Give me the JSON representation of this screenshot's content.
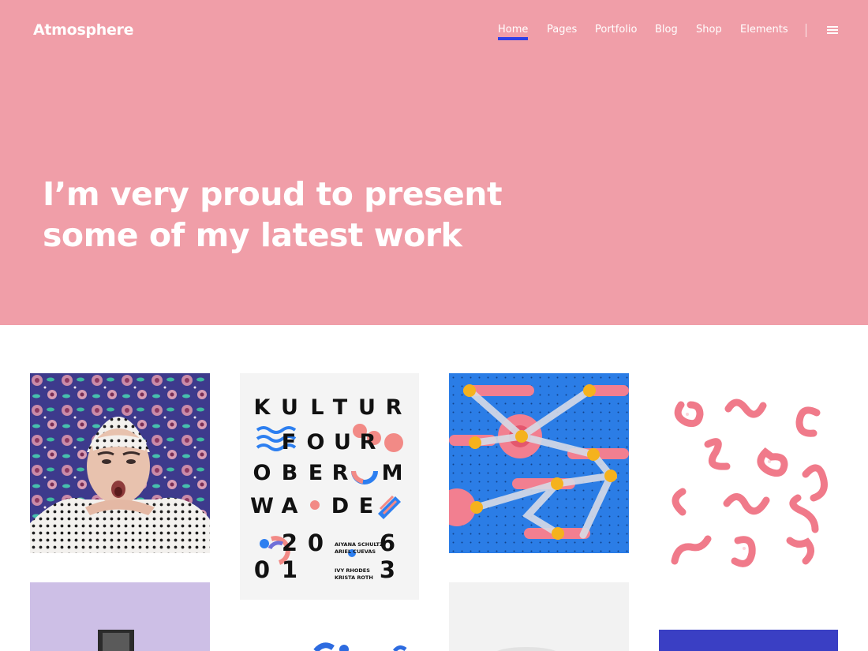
{
  "brand": {
    "name": "Atmosphere"
  },
  "nav": {
    "items": [
      {
        "label": "Home",
        "active": true
      },
      {
        "label": "Pages"
      },
      {
        "label": "Portfolio"
      },
      {
        "label": "Blog"
      },
      {
        "label": "Shop"
      },
      {
        "label": "Elements"
      }
    ],
    "menu_icon": "hamburger-icon"
  },
  "hero": {
    "title_line1": "I’m very proud to present",
    "title_line2": "some of my latest work",
    "background": "#f09ea8"
  },
  "accent": "#2f3fe6",
  "poster": {
    "row1": [
      "K",
      "U",
      "L",
      "T",
      "U",
      "R"
    ],
    "row2": [
      "F",
      "O",
      "U",
      "R"
    ],
    "row3": [
      "O",
      "B",
      "E",
      "R",
      "M"
    ],
    "row4": [
      "W",
      "A",
      "D",
      "E"
    ],
    "year_top": [
      "2",
      "0",
      "6"
    ],
    "year_bottom": [
      "0",
      "1",
      "3"
    ],
    "names_top": [
      "AIYANA SCHULTZ",
      "ARIEL CUEVAS"
    ],
    "names_bottom": [
      "IVY RHODES",
      "KRISTA ROTH"
    ]
  }
}
